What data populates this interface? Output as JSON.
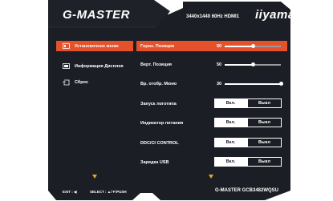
{
  "header": {
    "brand": "G-MASTER",
    "resolution": "3440x1440 60Hz HDMI1",
    "logo": "iiyama"
  },
  "sidebar": {
    "items": [
      {
        "label": "Установочное меню",
        "icon": "settings-menu-icon",
        "active": true
      },
      {
        "label": "Информация Дисплея",
        "icon": "display-info-icon",
        "active": false
      },
      {
        "label": "Сброс",
        "icon": "reset-icon",
        "active": false
      }
    ]
  },
  "settings": {
    "sliders": [
      {
        "label": "Гориз. Позиция",
        "value": "50",
        "level": 0.5,
        "active": true
      },
      {
        "label": "Верт. Позиция",
        "value": "50",
        "level": 0.5,
        "active": false
      },
      {
        "label": "Вр. отобр. Меню",
        "value": "30",
        "level": 1.0,
        "active": false
      }
    ],
    "toggles": [
      {
        "label": "Запуск логотипа",
        "on_label": "Вкл.",
        "off_label": "Выкл"
      },
      {
        "label": "Индикатор питания",
        "on_label": "Вкл.",
        "off_label": "Выкл"
      },
      {
        "label": "DDC/CI CONTROL",
        "on_label": "Вкл.",
        "off_label": "Выкл"
      },
      {
        "label": "Зарядка USB",
        "on_label": "Вкл.",
        "off_label": "Выкл"
      }
    ]
  },
  "footer": {
    "exit_label": "EXIT : ◀",
    "select_label": "SELECT : ▲/▼/PUSH",
    "model": "G-MASTER GCB3482WQSU"
  },
  "colors": {
    "panel": "#1b1e25",
    "accent": "#e4522b",
    "arrow": "#f0a030",
    "text": "#ffffff"
  }
}
